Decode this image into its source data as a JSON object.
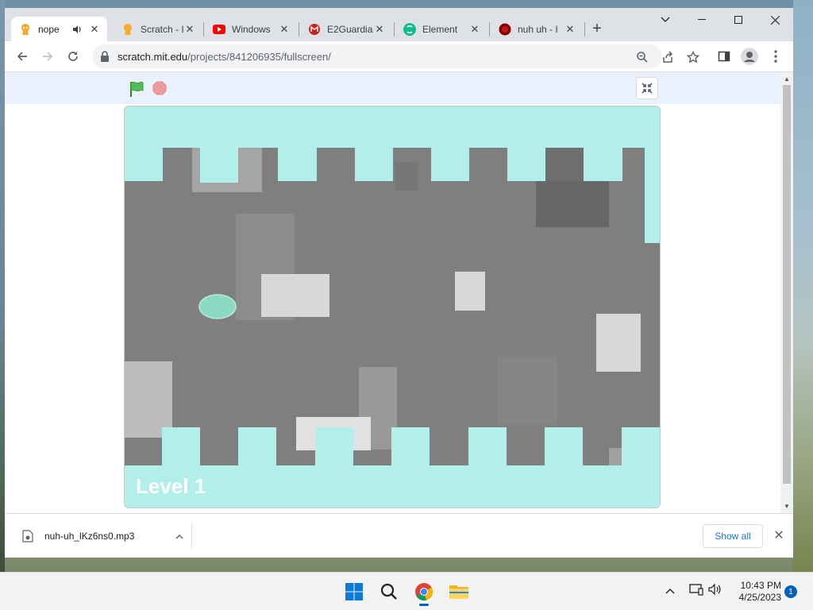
{
  "browser": {
    "tabs": [
      {
        "label": "nope",
        "icon": "scratch-cat-icon",
        "active": true,
        "audio": true
      },
      {
        "label": "Scratch - I",
        "icon": "scratch-cat-icon"
      },
      {
        "label": "Windows",
        "icon": "youtube-icon"
      },
      {
        "label": "E2Guardia",
        "icon": "gmail-icon"
      },
      {
        "label": "Element",
        "icon": "element-icon"
      },
      {
        "label": "nuh uh - I",
        "icon": "red-circle-icon"
      }
    ],
    "new_tab_label": "+",
    "address": {
      "host": "scratch.mit.edu",
      "path": "/projects/841206935/fullscreen/"
    },
    "accent": "#1a73e8"
  },
  "scratch": {
    "level_text": "Level 1",
    "colors": {
      "sky": "#b2efeb",
      "wall": "#7f7f7f",
      "player": "#8bd9c3"
    }
  },
  "downloads": {
    "file_name": "nuh-uh_lKz6ns0.mp3",
    "show_all_label": "Show all"
  },
  "taskbar": {
    "time": "10:43 PM",
    "date": "4/25/2023",
    "notification_count": "1"
  }
}
